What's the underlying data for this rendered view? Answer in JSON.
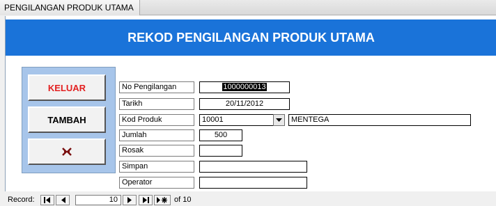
{
  "window": {
    "tab_title": "PENGILANGAN PRODUK UTAMA"
  },
  "form": {
    "heading": "REKOD PENGILANGAN PRODUK UTAMA",
    "colors": {
      "header_bg": "#1a73d9",
      "button_panel_bg": "#a7c5ea",
      "keluar_text": "#e32020"
    }
  },
  "buttons": {
    "keluar": "KELUAR",
    "tambah": "TAMBAH",
    "close_icon": "close-form-icon"
  },
  "fields": {
    "no_pengilangan": {
      "label": "No Pengilangan",
      "value": "1000000013"
    },
    "tarikh": {
      "label": "Tarikh",
      "value": "20/11/2012"
    },
    "kod_produk": {
      "label": "Kod Produk",
      "value": "10001",
      "description": "MENTEGA"
    },
    "jumlah": {
      "label": "Jumlah",
      "value": "500"
    },
    "rosak": {
      "label": "Rosak",
      "value": ""
    },
    "simpan": {
      "label": "Simpan",
      "value": ""
    },
    "operator": {
      "label": "Operator",
      "value": ""
    }
  },
  "record_nav": {
    "label": "Record:",
    "current": "10",
    "of_label": "of 10"
  }
}
